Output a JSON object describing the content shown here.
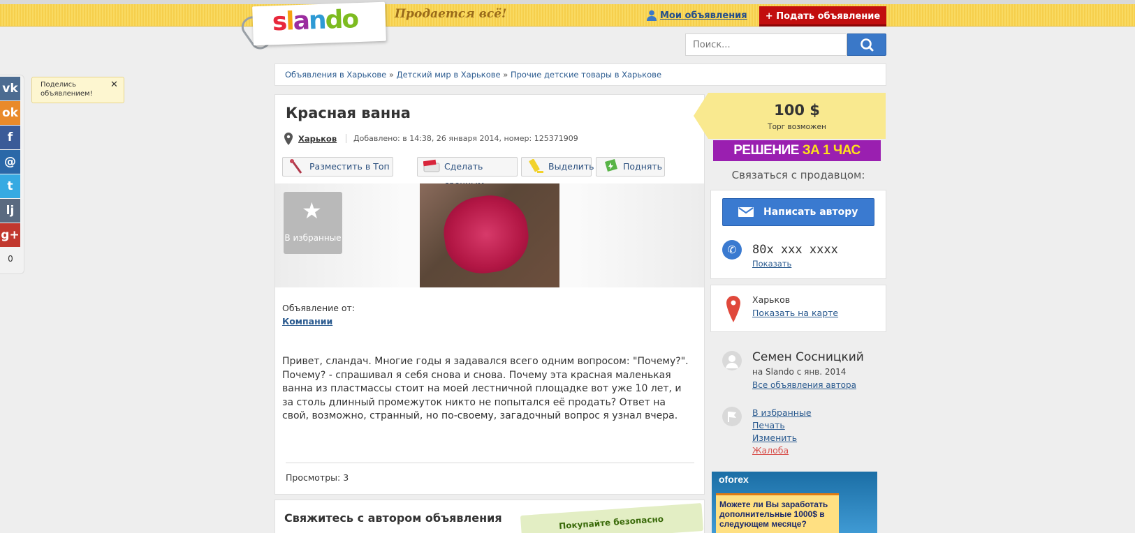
{
  "header": {
    "logo_text": "slando",
    "tagline": "Продается всё!",
    "my_ads": "Мои объявления",
    "post_ad": "+ Подать объявление",
    "search_placeholder": "Поиск..."
  },
  "breadcrumb": [
    "Объявления в Харькове",
    "Детский мир в Харькове",
    "Прочие детские товары в Харькове"
  ],
  "breadcrumb_sep": " » ",
  "share": {
    "tooltip": "Поделись объявлением!",
    "count": "0",
    "icons": [
      "vk-icon",
      "odnoklassniki-icon",
      "facebook-icon",
      "mail-icon",
      "twitter-icon",
      "livejournal-icon",
      "google-plus-icon"
    ],
    "glyphs": [
      "vk",
      "ok",
      "f",
      "@",
      "t",
      "lj",
      "g+"
    ],
    "colors": [
      "#4c6c91",
      "#e98a2a",
      "#3b5b98",
      "#2a68a8",
      "#36aae2",
      "#5a6a80",
      "#c1382e"
    ]
  },
  "ad": {
    "title": "Красная ванна",
    "city": "Харьков",
    "added": "Добавлено: в 14:38, 26 января 2014, номер: 125371909",
    "promo_buttons": [
      "Разместить в Топ",
      "Сделать срочным",
      "Выделить",
      "Поднять"
    ],
    "favorite": "В избранные",
    "from_label": "Объявление от:",
    "from_value": "Компании",
    "description": "Привет, сландач. Многие годы я задавался всего одним вопросом: \"Почему?\". Почему? - спрашивал я себя снова и снова. Почему эта красная маленькая ванна из пластмассы стоит на моей лестничной площадке вот уже 10 лет, и за столь длинный промежуток никто не попытался её продать? Ответ на свой, возможно, странный, но по-своему, загадочный вопрос я узнал вчера.",
    "views_label": "Просмотры:",
    "views": "3"
  },
  "contact_section": {
    "title": "Свяжитесь с автором объявления",
    "safe": "Покупайте безопасно"
  },
  "sidebar": {
    "price": "100 $",
    "bargain": "Торг возможен",
    "banner_a": "РЕШЕНИЕ",
    "banner_b": "ЗА 1 ЧАС",
    "contact_seller": "Связаться с продавцом:",
    "write_author": "Написать автору",
    "phone": "80x xxx xxxx",
    "show_phone": "Показать",
    "location_city": "Харьков",
    "show_map": "Показать на карте",
    "seller_name": "Семен Сосницкий",
    "seller_since": "на Slando с янв. 2014",
    "all_ads": "Все объявления автора",
    "actions": [
      "В избранные",
      "Печать",
      "Изменить",
      "Жалоба"
    ]
  },
  "advert": {
    "logo": "oforex",
    "text": "Можете ли Вы заработать дополнительные 1000$ в следующем месяце?"
  },
  "colors": {
    "header_yellow": "#f8d455",
    "post_red": "#c20e0e",
    "link_blue": "#2a5a8f",
    "button_blue": "#3a7ad0",
    "price_yellow": "#f9e98f",
    "banner_purple": "#9a1fb0",
    "complaint_red": "#d9534f"
  }
}
